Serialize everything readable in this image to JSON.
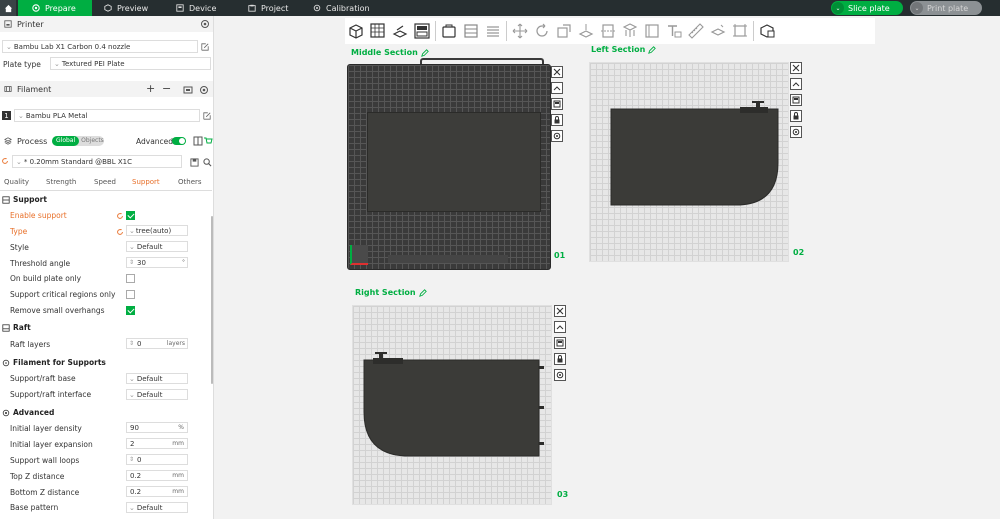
{
  "topbar": {
    "tabs": [
      {
        "label": "Prepare",
        "icon": "prepare-icon"
      },
      {
        "label": "Preview",
        "icon": "preview-icon"
      },
      {
        "label": "Device",
        "icon": "device-icon"
      },
      {
        "label": "Project",
        "icon": "project-icon"
      },
      {
        "label": "Calibration",
        "icon": "calibration-icon"
      }
    ],
    "slice_label": "Slice plate",
    "print_label": "Print plate",
    "colors": {
      "bar": "#262e30",
      "accent": "#00ae42"
    }
  },
  "printer": {
    "section_title": "Printer",
    "name": "Bambu Lab X1 Carbon 0.4 nozzle",
    "plate_type_label": "Plate type",
    "plate_type_value": "Textured PEI Plate"
  },
  "filament": {
    "section_title": "Filament",
    "slot_number": "1",
    "name": "Bambu PLA Metal",
    "slot_color": "#333333"
  },
  "process": {
    "section_title": "Process",
    "toggle_global": "Global",
    "toggle_objects": "Objects",
    "advanced_label": "Advanced",
    "preset": "* 0.20mm Standard @BBL X1C",
    "tabs": [
      "Quality",
      "Strength",
      "Speed",
      "Support",
      "Others"
    ],
    "active_tab": "Support"
  },
  "support": {
    "group_support": "Support",
    "enable_support": "Enable support",
    "type_label": "Type",
    "type_value": "tree(auto)",
    "style_label": "Style",
    "style_value": "Default",
    "threshold_label": "Threshold angle",
    "threshold_value": "30",
    "threshold_unit": "°",
    "on_build_plate": "On build plate only",
    "critical_regions": "Support critical regions only",
    "remove_small": "Remove small overhangs",
    "group_raft": "Raft",
    "raft_layers_label": "Raft layers",
    "raft_layers_value": "0",
    "raft_layers_unit": "layers",
    "group_filament": "Filament for Supports",
    "raft_base_label": "Support/raft base",
    "raft_base_value": "Default",
    "raft_interface_label": "Support/raft interface",
    "raft_interface_value": "Default",
    "group_advanced": "Advanced",
    "initial_density_label": "Initial layer density",
    "initial_density_value": "90",
    "initial_density_unit": "%",
    "initial_expansion_label": "Initial layer expansion",
    "initial_expansion_value": "2",
    "initial_expansion_unit": "mm",
    "wall_loops_label": "Support wall loops",
    "wall_loops_value": "0",
    "top_z_label": "Top Z distance",
    "top_z_value": "0.2",
    "top_z_unit": "mm",
    "bottom_z_label": "Bottom Z distance",
    "bottom_z_value": "0.2",
    "bottom_z_unit": "mm",
    "base_pattern_label": "Base pattern",
    "base_pattern_value": "Default"
  },
  "plates": [
    {
      "name": "Middle Section",
      "number": "01"
    },
    {
      "name": "Left Section",
      "number": "02"
    },
    {
      "name": "Right Section",
      "number": "03"
    }
  ]
}
